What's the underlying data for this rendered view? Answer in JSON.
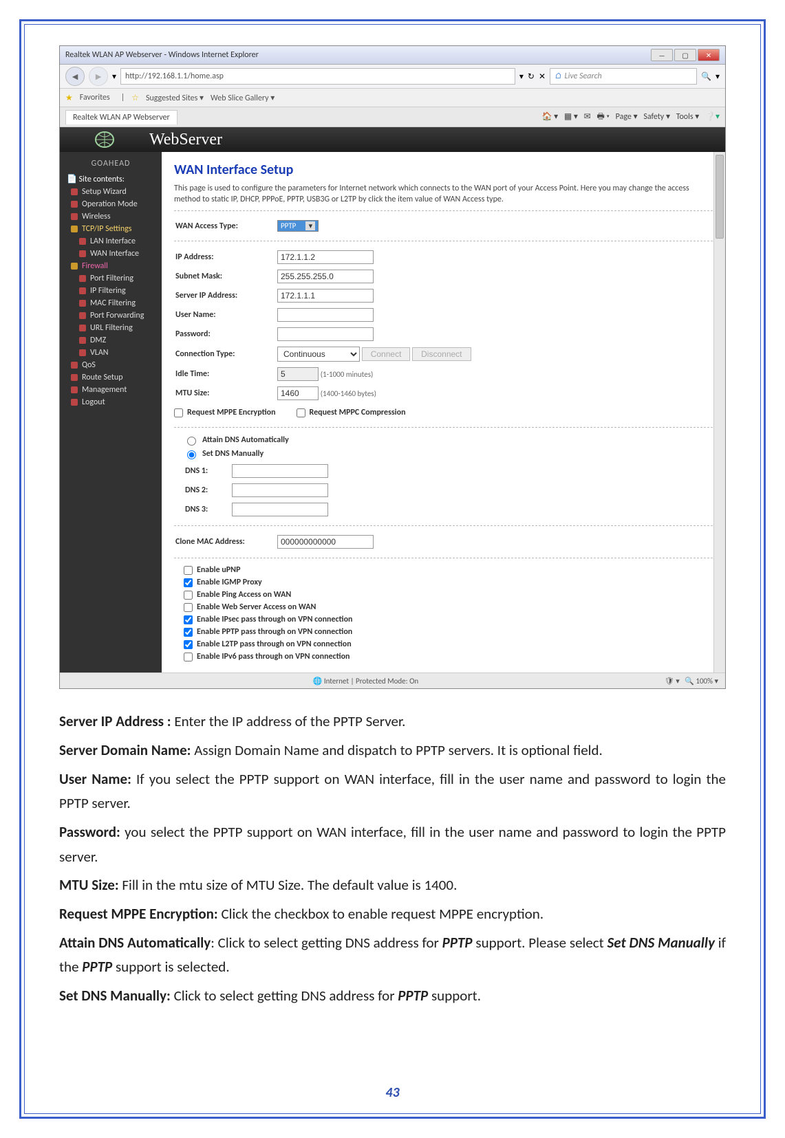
{
  "browser": {
    "title": "Realtek WLAN AP Webserver - Windows Internet Explorer",
    "url": "http://192.168.1.1/home.asp",
    "search_placeholder": "Live Search",
    "fav_label": "Favorites",
    "suggested": "Suggested Sites ▾",
    "webslice": "Web Slice Gallery ▾",
    "tab": "Realtek WLAN AP Webserver",
    "tools": {
      "page": "Page ▾",
      "safety": "Safety ▾",
      "tools": "Tools ▾"
    },
    "status_left": "Internet | Protected Mode: On",
    "status_zoom": "100%"
  },
  "header": {
    "brand": "GOAHEAD",
    "title": "WebServer"
  },
  "sidebar": {
    "root": "Site contents:",
    "items": [
      "Setup Wizard",
      "Operation Mode",
      "Wireless",
      "TCP/IP Settings",
      "LAN Interface",
      "WAN Interface",
      "Firewall",
      "Port Filtering",
      "IP Filtering",
      "MAC Filtering",
      "Port Forwarding",
      "URL Filtering",
      "DMZ",
      "VLAN",
      "QoS",
      "Route Setup",
      "Management",
      "Logout"
    ]
  },
  "wan": {
    "title": "WAN Interface Setup",
    "desc": "This page is used to configure the parameters for Internet network which connects to the WAN port of your Access Point. Here you may change the access method to static IP, DHCP, PPPoE, PPTP, USB3G or L2TP by click the item value of WAN Access type.",
    "access_type_label": "WAN Access Type:",
    "access_type_value": "PPTP",
    "ip_label": "IP Address:",
    "ip_value": "172.1.1.2",
    "mask_label": "Subnet Mask:",
    "mask_value": "255.255.255.0",
    "server_label": "Server IP Address:",
    "server_value": "172.1.1.1",
    "user_label": "User Name:",
    "user_value": "",
    "pass_label": "Password:",
    "pass_value": "",
    "conn_label": "Connection Type:",
    "conn_value": "Continuous",
    "btn_connect": "Connect",
    "btn_disconnect": "Disconnect",
    "idle_label": "Idle Time:",
    "idle_value": "5",
    "idle_note": "(1-1000 minutes)",
    "mtu_label": "MTU Size:",
    "mtu_value": "1460",
    "mtu_note": "(1400-1460 bytes)",
    "mppe": "Request MPPE Encryption",
    "mppc": "Request MPPC Compression",
    "dns_auto": "Attain DNS Automatically",
    "dns_manual": "Set DNS Manually",
    "dns1": "DNS 1:",
    "dns2": "DNS 2:",
    "dns3": "DNS 3:",
    "clone_label": "Clone MAC Address:",
    "clone_value": "000000000000",
    "cb": [
      "Enable uPNP",
      "Enable IGMP Proxy",
      "Enable Ping Access on WAN",
      "Enable Web Server Access on WAN",
      "Enable IPsec pass through on VPN connection",
      "Enable PPTP pass through on VPN connection",
      "Enable L2TP pass through on VPN connection",
      "Enable IPv6 pass through on VPN connection"
    ],
    "cb_checked": [
      false,
      true,
      false,
      false,
      true,
      true,
      true,
      false
    ]
  },
  "doc": {
    "p1a": "Server IP Address : ",
    "p1b": "Enter the IP address of the PPTP Server.",
    "p2a": "Server Domain Name: ",
    "p2b": "Assign Domain Name and dispatch to PPTP servers. It is optional field.",
    "p3a": "User Name: ",
    "p3b": "If you select the PPTP support on WAN interface, fill in the user name and password to login the PPTP server.",
    "p4a": "Password: ",
    "p4b": "you select the PPTP support on WAN interface, fill in the user name and password to login the PPTP server.",
    "p5a": "MTU Size: ",
    "p5b": "Fill in the mtu size of MTU Size. The default value is 1400.",
    "p6a": "Request MPPE Encryption: ",
    "p6b": "Click the checkbox to enable request MPPE encryption.",
    "p7a": "Attain DNS Automatically",
    "p7b": ": Click to select getting DNS address for ",
    "p7c": "PPTP",
    "p7d": " support. Please select ",
    "p7e": "Set DNS Manually",
    "p7f": " if the ",
    "p7g": "PPTP",
    "p7h": " support is selected.",
    "p8a": "Set DNS Manually: ",
    "p8b": "Click to select getting DNS address for ",
    "p8c": "PPTP",
    "p8d": " support."
  },
  "pagenum": "43"
}
